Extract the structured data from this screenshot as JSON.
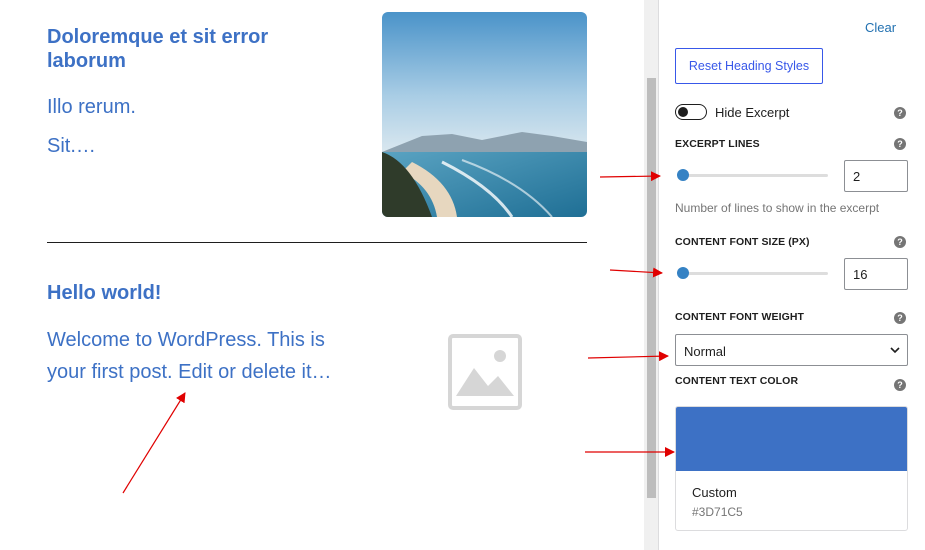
{
  "posts": [
    {
      "title": "Doloremque et sit error laborum",
      "excerpt_line1": "Illo rerum.",
      "excerpt_line2": "Sit.…"
    },
    {
      "title": "Hello world!",
      "excerpt_line1": "Welcome to WordPress. This is",
      "excerpt_line2": "your first post. Edit or delete it…"
    }
  ],
  "panel": {
    "clear_label": "Clear",
    "reset_button": "Reset Heading Styles",
    "hide_excerpt": {
      "label": "Hide Excerpt",
      "checked": false
    },
    "excerpt_lines": {
      "label": "EXCERPT LINES",
      "value": "2",
      "slider_fraction": 0.0,
      "help": "Number of lines to show in the excerpt"
    },
    "content_font_size": {
      "label": "CONTENT FONT SIZE (PX)",
      "value": "16",
      "slider_fraction": 0.0
    },
    "content_font_weight": {
      "label": "CONTENT FONT WEIGHT",
      "selected": "Normal"
    },
    "content_text_color": {
      "label": "CONTENT TEXT COLOR",
      "name": "Custom",
      "hex": "#3D71C5",
      "swatch": "#3d71c5"
    },
    "help_icon": "?"
  },
  "colors": {
    "accent": "#3d71c5",
    "link": "#2271b1",
    "button": "#3858e9",
    "slider": "#3582c4",
    "annotation_arrow": "#e00000"
  }
}
